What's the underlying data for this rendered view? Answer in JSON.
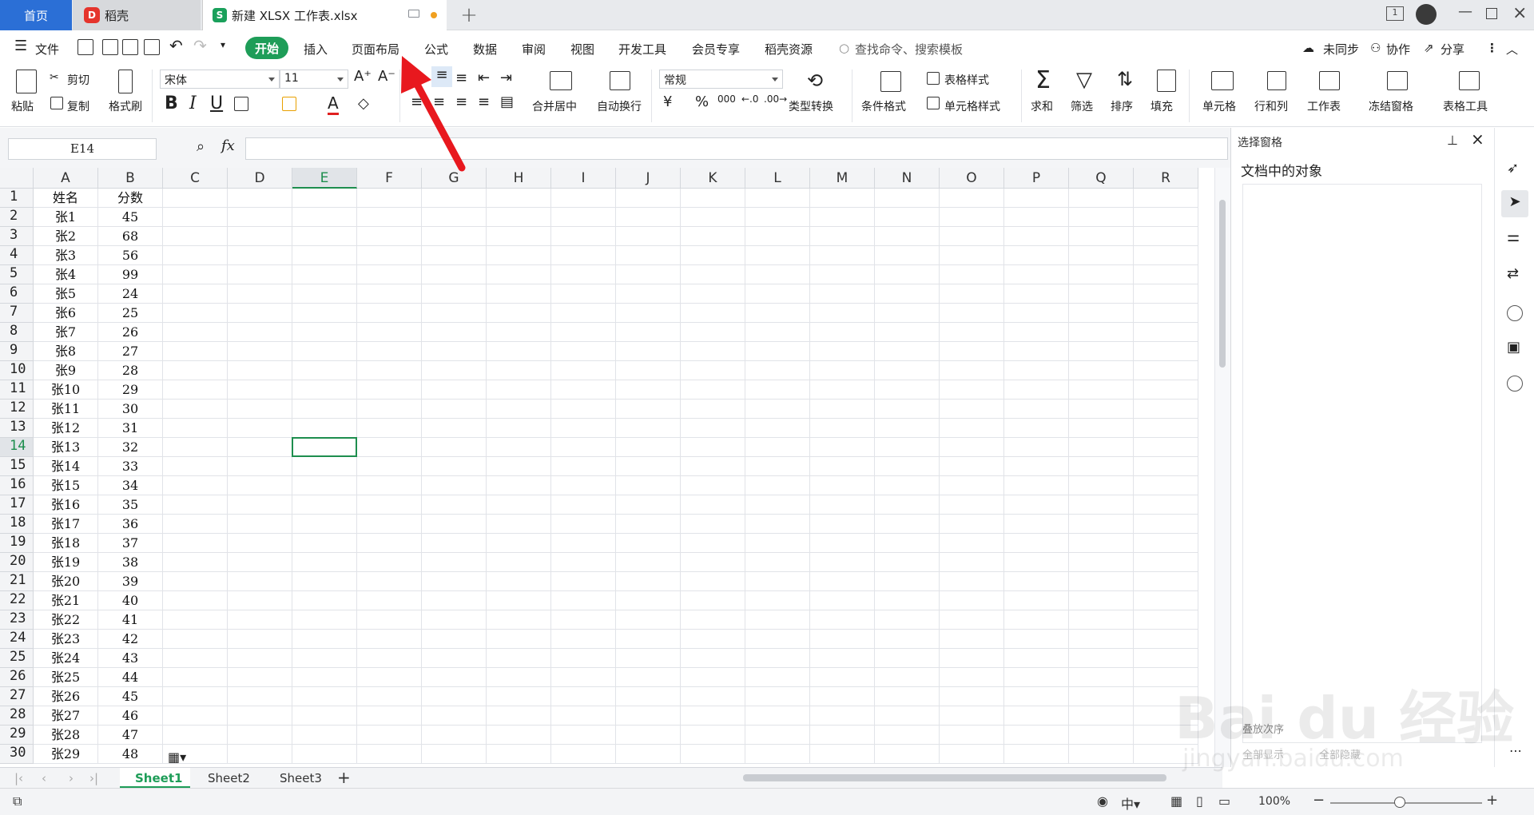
{
  "tabs": {
    "home": "首页",
    "daoke": "稻壳",
    "file": "新建 XLSX 工作表.xlsx"
  },
  "menu": {
    "file": "文件",
    "start": "开始",
    "insert": "插入",
    "page_layout": "页面布局",
    "formula": "公式",
    "data": "数据",
    "review": "审阅",
    "view": "视图",
    "dev": "开发工具",
    "member": "会员专享",
    "resources": "稻壳资源",
    "search_placeholder": "查找命令、搜索模板",
    "sync": "未同步",
    "collab": "协作",
    "share": "分享"
  },
  "ribbon": {
    "paste": "粘贴",
    "cut": "剪切",
    "copy": "复制",
    "format_painter": "格式刷",
    "font_name": "宋体",
    "font_size": "11",
    "merge_center": "合并居中",
    "wrap": "自动换行",
    "number_format": "常规",
    "type_convert": "类型转换",
    "cond_format": "条件格式",
    "table_style": "表格样式",
    "cell_style": "单元格样式",
    "sum": "求和",
    "filter": "筛选",
    "sort": "排序",
    "fill": "填充",
    "cell": "单元格",
    "row_col": "行和列",
    "worksheet": "工作表",
    "freeze": "冻结窗格",
    "table_tools": "表格工具",
    "currency": "¥",
    "percent": "%",
    "thousands": "000"
  },
  "formula_bar": {
    "name_box": "E14",
    "fx": "fx"
  },
  "columns": [
    "A",
    "B",
    "C",
    "D",
    "E",
    "F",
    "G",
    "H",
    "I",
    "J",
    "K",
    "L",
    "M",
    "N",
    "O",
    "P",
    "Q",
    "R"
  ],
  "rows": [
    [
      "1",
      "姓名",
      "分数"
    ],
    [
      "2",
      "张1",
      "45"
    ],
    [
      "3",
      "张2",
      "68"
    ],
    [
      "4",
      "张3",
      "56"
    ],
    [
      "5",
      "张4",
      "99"
    ],
    [
      "6",
      "张5",
      "24"
    ],
    [
      "7",
      "张6",
      "25"
    ],
    [
      "8",
      "张7",
      "26"
    ],
    [
      "9",
      "张8",
      "27"
    ],
    [
      "10",
      "张9",
      "28"
    ],
    [
      "11",
      "张10",
      "29"
    ],
    [
      "12",
      "张11",
      "30"
    ],
    [
      "13",
      "张12",
      "31"
    ],
    [
      "14",
      "张13",
      "32"
    ],
    [
      "15",
      "张14",
      "33"
    ],
    [
      "16",
      "张15",
      "34"
    ],
    [
      "17",
      "张16",
      "35"
    ],
    [
      "18",
      "张17",
      "36"
    ],
    [
      "19",
      "张18",
      "37"
    ],
    [
      "20",
      "张19",
      "38"
    ],
    [
      "21",
      "张20",
      "39"
    ],
    [
      "22",
      "张21",
      "40"
    ],
    [
      "23",
      "张22",
      "41"
    ],
    [
      "24",
      "张23",
      "42"
    ],
    [
      "25",
      "张24",
      "43"
    ],
    [
      "26",
      "张25",
      "44"
    ],
    [
      "27",
      "张26",
      "45"
    ],
    [
      "28",
      "张27",
      "46"
    ],
    [
      "29",
      "张28",
      "47"
    ],
    [
      "30",
      "张29",
      "48"
    ]
  ],
  "selected_cell": {
    "col": "E",
    "row": "14"
  },
  "pane": {
    "title": "选择窗格",
    "heading": "文档中的对象",
    "show_all": "全部显示",
    "hide_all": "全部隐藏",
    "order": "叠放次序"
  },
  "sheets": [
    "Sheet1",
    "Sheet2",
    "Sheet3"
  ],
  "status": {
    "zoom": "100%"
  },
  "watermark": {
    "brand": "Bai du 经验",
    "url": "jingyan.baidu.com"
  },
  "colors": {
    "accent_green": "#1e9d58",
    "home_tab": "#2b6fd6",
    "arrow_red": "#e8181e"
  }
}
